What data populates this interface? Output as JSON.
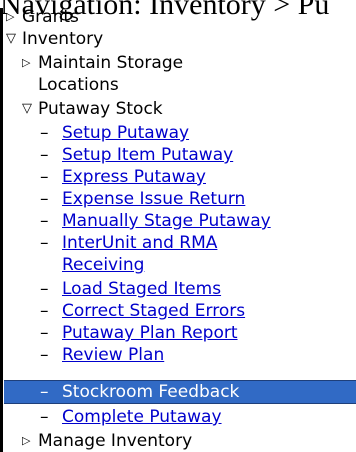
{
  "breadcrumb": {
    "text": "Navigation: Inventory > Pu"
  },
  "menu": {
    "grants": "Grants",
    "inventory": "Inventory",
    "maintain_storage_line1": "Maintain Storage",
    "maintain_storage_line2": "Locations",
    "putaway_stock": "Putaway Stock",
    "items": [
      "Setup Putaway",
      "Setup Item Putaway",
      "Express Putaway",
      "Expense Issue Return",
      "Manually Stage Putaway",
      "InterUnit and RMA",
      "Receiving",
      "Load Staged Items",
      "Correct Staged Errors",
      "Putaway Plan Report",
      "Review Plan",
      "Stockroom Feedback",
      "Complete Putaway"
    ],
    "manage_inventory": "Manage Inventory",
    "dash": "–"
  },
  "colors": {
    "link": "#0000cc",
    "selected_bg": "#316ac5",
    "selected_text": "#ffffff"
  }
}
